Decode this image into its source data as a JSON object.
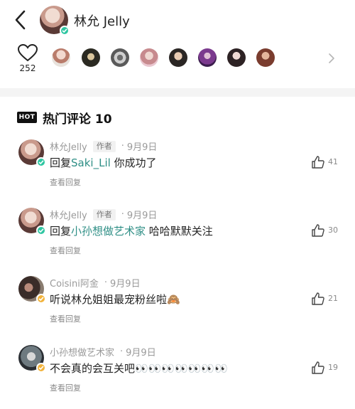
{
  "header": {
    "user_name": "林允 Jelly"
  },
  "likes": {
    "count": "252"
  },
  "hot_comments": {
    "badge": "HOT",
    "title": "热门评论 10"
  },
  "comments": [
    {
      "name": "林允Jelly",
      "author_tag": "作者",
      "dot": "·",
      "date": "9月9日",
      "prefix": "回复",
      "mention": "Saki_Lil",
      "text": " 你成功了",
      "reply": "查看回复",
      "likes": "41"
    },
    {
      "name": "林允Jelly",
      "author_tag": "作者",
      "dot": "·",
      "date": "9月9日",
      "prefix": "回复",
      "mention": "小孙想做艺术家",
      "text": " 哈哈默默关注",
      "reply": "查看回复",
      "likes": "30"
    },
    {
      "name": "Coisini阿金",
      "dot": "·",
      "date": "9月9日",
      "prefix": "",
      "mention": "",
      "text": "听说林允姐姐最宠粉丝啦🙈",
      "reply": "查看回复",
      "likes": "21"
    },
    {
      "name": "小孙想做艺术家",
      "dot": "·",
      "date": "9月9日",
      "prefix": "",
      "mention": "",
      "text": "不会真的会互关吧👀👀👀👀👀👀👀",
      "reply": "查看回复",
      "likes": "19"
    }
  ],
  "colors": {
    "verify_green": "#2fc6a2",
    "verify_gold": "#f2b33b",
    "mention": "#2f8f86"
  }
}
